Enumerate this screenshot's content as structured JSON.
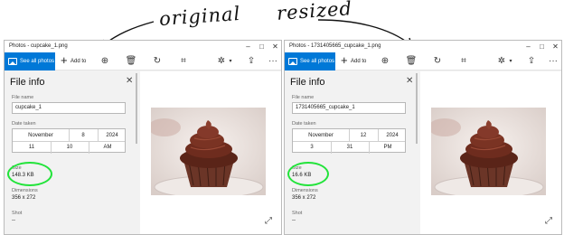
{
  "annotations": {
    "left_label": "original",
    "right_label": "resized"
  },
  "toolbar": {
    "see_all": "See all photos",
    "add_to": "Add to",
    "icons": [
      "zoom-in-icon",
      "delete-icon",
      "rotate-icon",
      "crop-icon",
      "edit-icon",
      "share-icon",
      "more-icon"
    ]
  },
  "panel_labels": {
    "heading": "File info",
    "file_name": "File name",
    "date_taken": "Date taken",
    "size": "Size",
    "dimensions": "Dimensions",
    "shot": "Shot"
  },
  "windows": [
    {
      "title": "Photos - cupcake_1.png",
      "file_name": "cupcake_1",
      "date": {
        "month": "November",
        "day": "8",
        "year": "2024",
        "hour": "11",
        "minute": "10",
        "ampm": "AM"
      },
      "size": "148.3 KB",
      "dimensions": "356 x 272",
      "shot": "--"
    },
    {
      "title": "Photos - 1731405665_cupcake_1.png",
      "file_name": "1731405665_cupcake_1",
      "date": {
        "month": "November",
        "day": "12",
        "year": "2024",
        "hour": "3",
        "minute": "31",
        "ampm": "PM"
      },
      "size": "16.6 KB",
      "dimensions": "356 x 272",
      "shot": "--"
    }
  ],
  "colors": {
    "accent": "#0078d7",
    "highlight": "#22e33a"
  }
}
